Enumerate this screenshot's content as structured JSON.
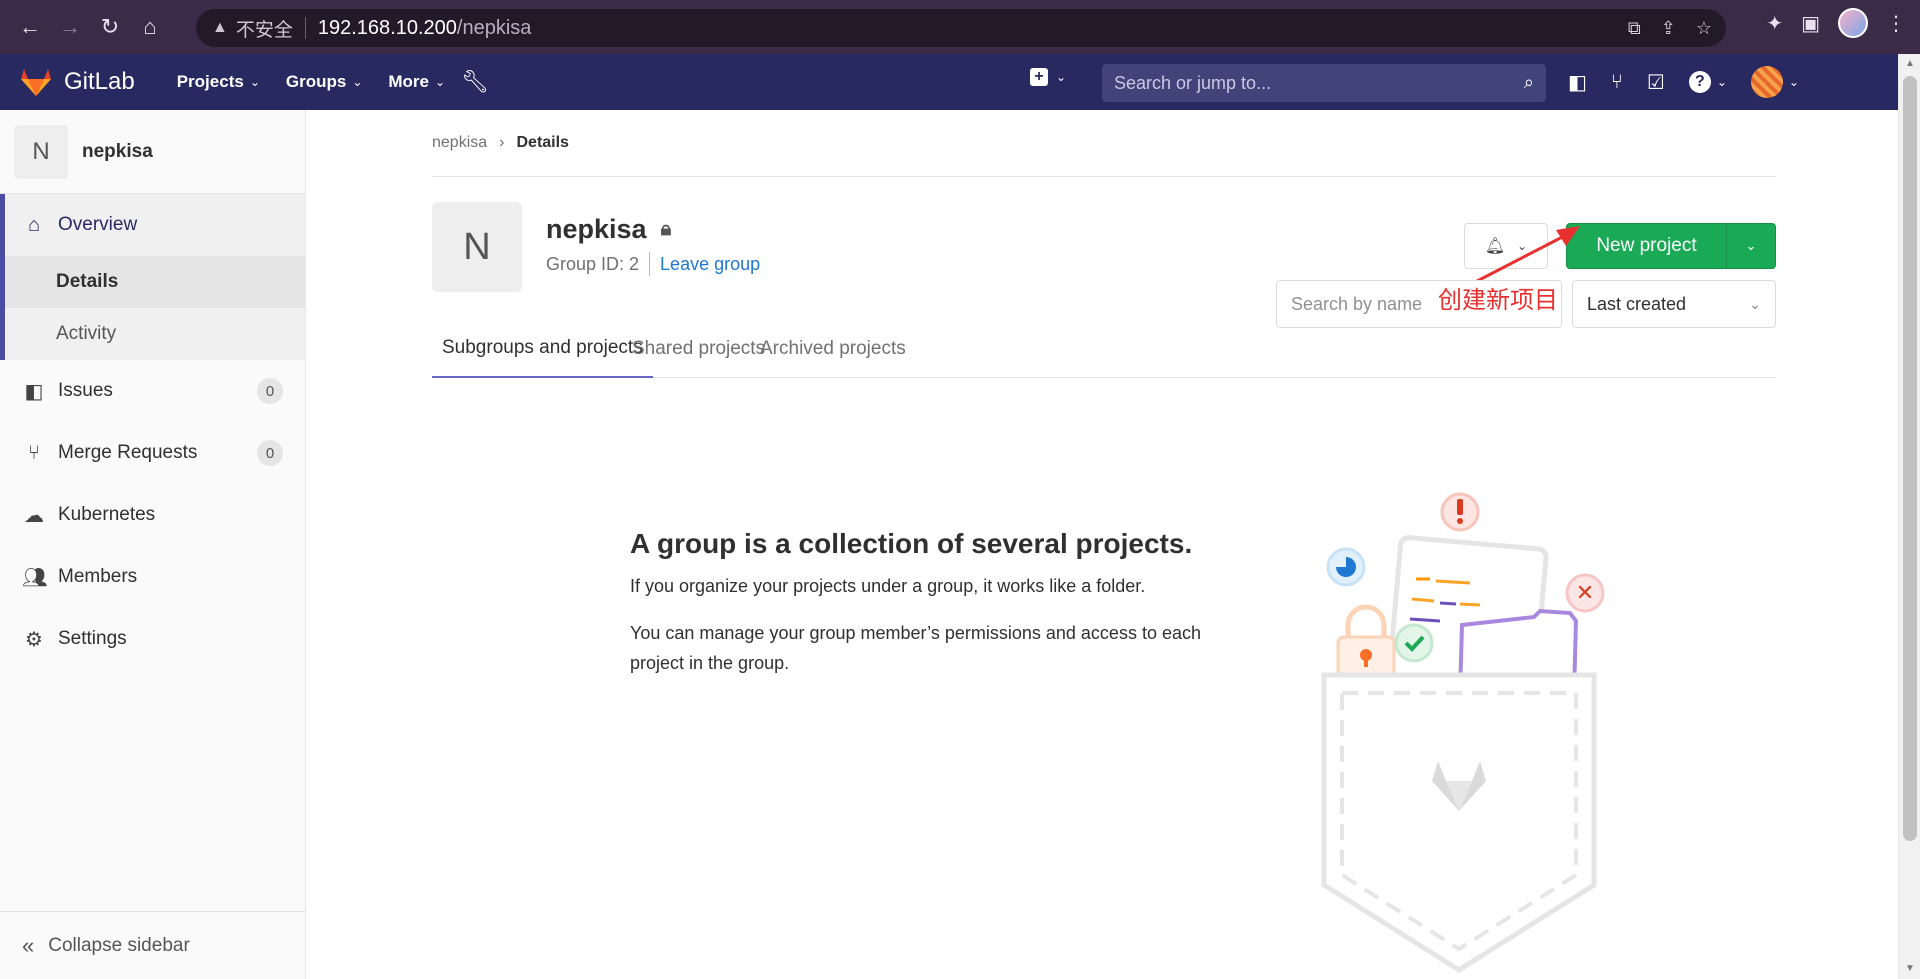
{
  "browser": {
    "insecure_label": "不安全",
    "url_host": "192.168.10.200",
    "url_path": "/nepkisa"
  },
  "topnav": {
    "brand": "GitLab",
    "menu": [
      {
        "label": "Projects"
      },
      {
        "label": "Groups"
      },
      {
        "label": "More"
      }
    ],
    "search_placeholder": "Search or jump to..."
  },
  "sidebar": {
    "avatar_letter": "N",
    "group_name": "nepkisa",
    "overview_label": "Overview",
    "overview_sub": [
      {
        "label": "Details"
      },
      {
        "label": "Activity"
      }
    ],
    "items": [
      {
        "label": "Issues",
        "count": "0",
        "icon": "issues-icon"
      },
      {
        "label": "Merge Requests",
        "count": "0",
        "icon": "merge-request-icon"
      },
      {
        "label": "Kubernetes",
        "icon": "kubernetes-icon"
      },
      {
        "label": "Members",
        "icon": "members-icon"
      },
      {
        "label": "Settings",
        "icon": "gear-icon"
      }
    ],
    "collapse_label": "Collapse sidebar"
  },
  "breadcrumb": {
    "parent": "nepkisa",
    "current": "Details"
  },
  "group": {
    "avatar_letter": "N",
    "name": "nepkisa",
    "id_text": "Group ID: 2",
    "leave_label": "Leave group",
    "new_project_label": "New project"
  },
  "tabs": [
    {
      "label": "Subgroups and projects"
    },
    {
      "label": "Shared projects"
    },
    {
      "label": "Archived projects"
    }
  ],
  "filter": {
    "search_placeholder": "Search by name",
    "sort_label": "Last created"
  },
  "annotation": "创建新项目",
  "empty_state": {
    "title": "A group is a collection of several projects.",
    "p1": "If you organize your projects under a group, it works like a folder.",
    "p2": "You can manage your group member’s permissions and access to each project in the group."
  },
  "colors": {
    "nav_bg": "#292961",
    "primary_green": "#1aaa55",
    "link_blue": "#1f78d1",
    "annotation_red": "#e8312f"
  }
}
